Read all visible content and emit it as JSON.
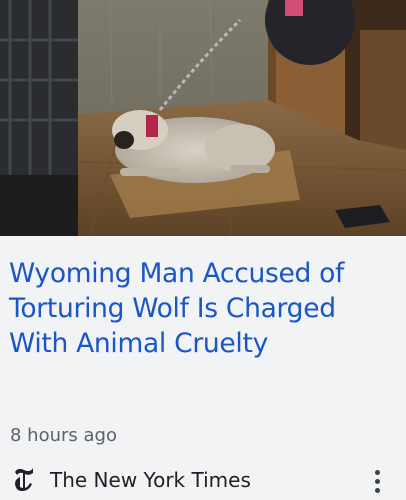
{
  "article": {
    "headline": "Wyoming Man Accused of Torturing Wolf Is Charged With Animal Cruelty",
    "timestamp": "8 hours ago",
    "source_name": "The New York Times",
    "source_logo_glyph": "𝕿",
    "more_icon": "more-vert-icon"
  },
  "colors": {
    "headline": "#1a55c9",
    "background": "#f1f3f4",
    "meta_text": "#5f6368"
  }
}
